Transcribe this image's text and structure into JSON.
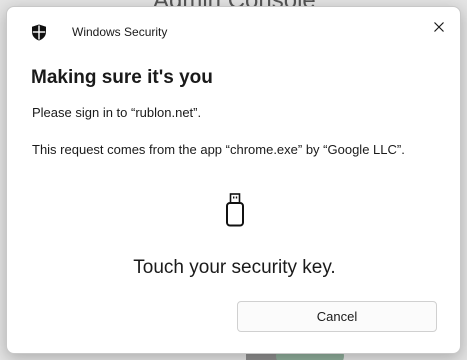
{
  "background": {
    "title": "Admin Console"
  },
  "dialog": {
    "app_title": "Windows Security",
    "heading": "Making sure it's you",
    "sign_in_text": "Please sign in to “rublon.net”.",
    "request_text": "This request comes from the app “chrome.exe” by “Google LLC”.",
    "prompt": "Touch your security key.",
    "cancel_label": "Cancel",
    "icons": {
      "title_icon": "shield-icon",
      "close_icon": "close-icon",
      "key_icon": "usb-security-key-icon"
    }
  },
  "colors": {
    "text": "#1a1a1a",
    "dialog_bg": "#ffffff",
    "button_bg": "#fbfbfb",
    "button_border": "#d0d0d0"
  }
}
